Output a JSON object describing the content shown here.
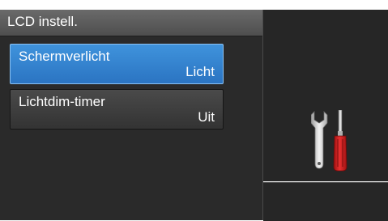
{
  "header": {
    "title": "LCD instell."
  },
  "menu": {
    "items": [
      {
        "label": "Schermverlicht",
        "value": "Licht"
      },
      {
        "label": "Lichtdim-timer",
        "value": "Uit"
      }
    ]
  },
  "icons": {
    "settings": "tools-icon"
  },
  "colors": {
    "selected": "#2b74c2",
    "panel": "#2a2a2a",
    "screwdriver_handle": "#d42020"
  }
}
